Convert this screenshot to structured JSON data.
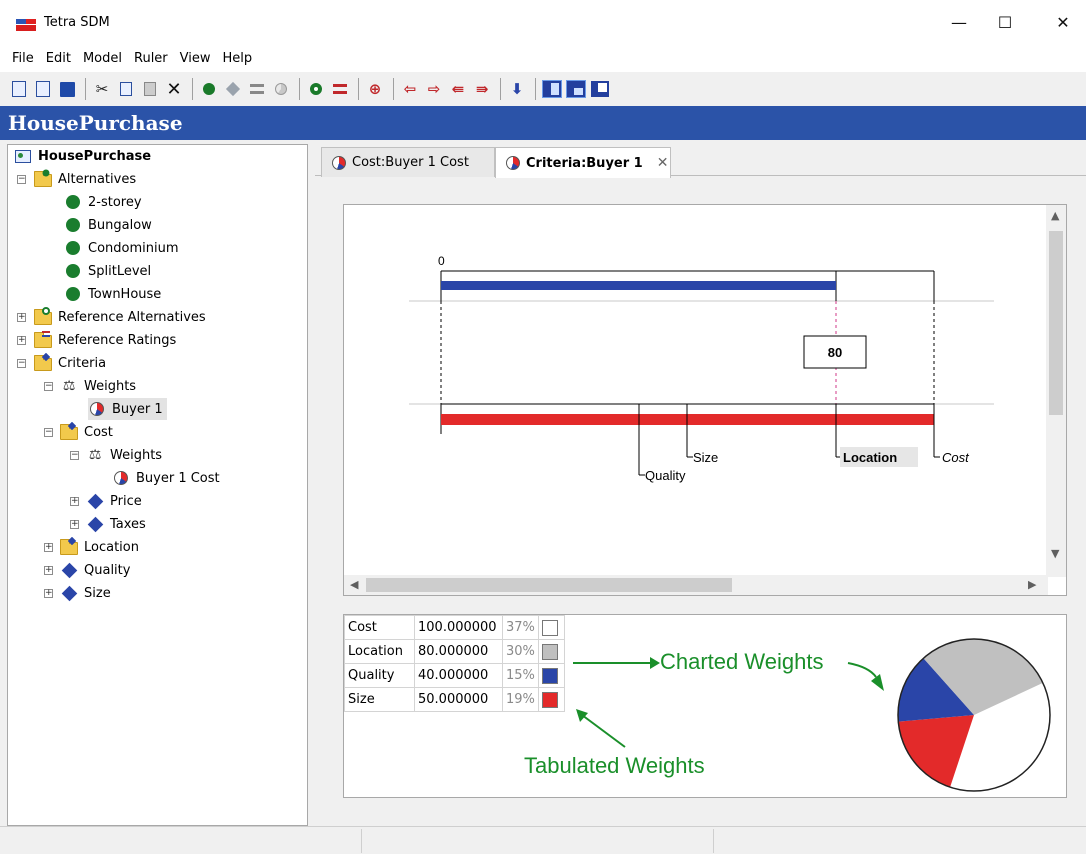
{
  "window": {
    "title": "Tetra SDM",
    "minimize": "—",
    "maximize": "☐",
    "close": "✕"
  },
  "menu": [
    {
      "label": "File"
    },
    {
      "label": "Edit"
    },
    {
      "label": "Model"
    },
    {
      "label": "Ruler"
    },
    {
      "label": "View"
    },
    {
      "label": "Help"
    }
  ],
  "header": {
    "title": "HousePurchase"
  },
  "tree": {
    "root": "HousePurchase",
    "alternatives": "Alternatives",
    "alt_items": [
      "2-storey",
      "Bungalow",
      "Condominium",
      "SplitLevel",
      "TownHouse"
    ],
    "reference_alternatives": "Reference Alternatives",
    "reference_ratings": "Reference Ratings",
    "criteria": "Criteria",
    "weights": "Weights",
    "buyer1": "Buyer 1",
    "cost": "Cost",
    "cost_weights": "Weights",
    "buyer1_cost": "Buyer 1 Cost",
    "price": "Price",
    "taxes": "Taxes",
    "location": "Location",
    "quality": "Quality",
    "size": "Size",
    "expand_symbol": "+",
    "collapse_symbol": "−"
  },
  "tabs": [
    {
      "label": "Cost:Buyer 1 Cost",
      "active": false
    },
    {
      "label": "Criteria:Buyer 1",
      "active": true,
      "close": "✕"
    }
  ],
  "ruler": {
    "zero_label": "0",
    "value_box": "80",
    "labels": {
      "quality": "Quality",
      "size": "Size",
      "location": "Location",
      "cost": "Cost"
    },
    "scroll_up": "▲",
    "scroll_down": "▼",
    "scroll_left": "◀",
    "scroll_right": "▶"
  },
  "weights_table": [
    {
      "name": "Cost",
      "value": "100.000000",
      "pct": "37%",
      "color": "#ffffff"
    },
    {
      "name": "Location",
      "value": "80.000000",
      "pct": "30%",
      "color": "#c0c0c0"
    },
    {
      "name": "Quality",
      "value": "40.000000",
      "pct": "15%",
      "color": "#2a45a8"
    },
    {
      "name": "Size",
      "value": "50.000000",
      "pct": "19%",
      "color": "#e32a2a"
    }
  ],
  "annotations": {
    "charted": "Charted Weights",
    "tabulated": "Tabulated Weights"
  },
  "colors": {
    "accent": "#2b53a8",
    "red": "#e32a2a",
    "blue": "#2a45a8",
    "gray": "#c0c0c0",
    "green": "#1a8f2a"
  }
}
